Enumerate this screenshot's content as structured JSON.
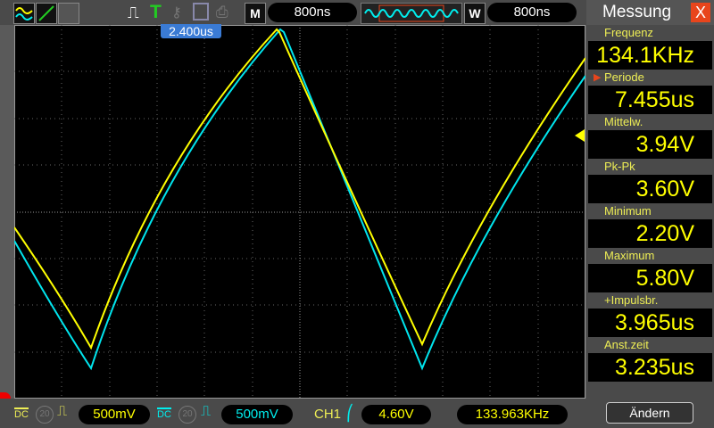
{
  "toolbar": {
    "mode_label": "M",
    "timebase": "800ns",
    "window_label": "W",
    "window_timebase": "800ns",
    "trigger_icon_label": "T"
  },
  "trigger_position": "2.400us",
  "bottom": {
    "ch1_coupling": "DC",
    "ch1_bw": "20",
    "ch1_scale": "500mV",
    "ch2_coupling": "DC",
    "ch2_bw": "20",
    "ch2_scale": "500mV",
    "trigger_source": "CH1",
    "trigger_level": "4.60V",
    "frequency": "133.963KHz"
  },
  "measure": {
    "title": "Messung",
    "close": "X",
    "items": [
      {
        "label": "Frequenz",
        "value": "134.1KHz"
      },
      {
        "label": "Periode",
        "value": "7.455us"
      },
      {
        "label": "Mittelw.",
        "value": "3.94V"
      },
      {
        "label": "Pk-Pk",
        "value": "3.60V"
      },
      {
        "label": "Minimum",
        "value": "2.20V"
      },
      {
        "label": "Maximum",
        "value": "5.80V"
      },
      {
        "label": "+Impulsbr.",
        "value": "3.965us"
      },
      {
        "label": "Anst.zeit",
        "value": "3.235us"
      }
    ],
    "change_button": "Ändern"
  },
  "colors": {
    "ch1": "#ffff00",
    "ch2": "#00e5ee",
    "accent": "#e8451c"
  }
}
